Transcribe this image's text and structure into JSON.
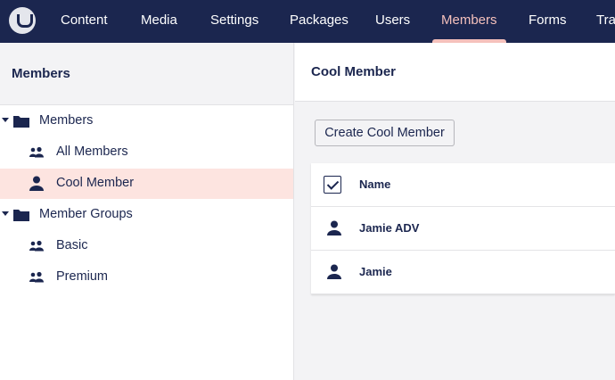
{
  "nav": {
    "items": [
      {
        "label": "Content",
        "active": false
      },
      {
        "label": "Media",
        "active": false
      },
      {
        "label": "Settings",
        "active": false
      },
      {
        "label": "Packages",
        "active": false
      },
      {
        "label": "Users",
        "active": false
      },
      {
        "label": "Members",
        "active": true
      },
      {
        "label": "Forms",
        "active": false
      },
      {
        "label": "Tra",
        "active": false
      }
    ]
  },
  "sidebar": {
    "title": "Members",
    "tree": [
      {
        "label": "Members",
        "icon": "folder-icon",
        "expanded": true
      },
      {
        "label": "All Members",
        "icon": "users-icon"
      },
      {
        "label": "Cool Member",
        "icon": "user-icon",
        "selected": true
      },
      {
        "label": "Member Groups",
        "icon": "folder-icon",
        "expanded": true
      },
      {
        "label": "Basic",
        "icon": "users-icon"
      },
      {
        "label": "Premium",
        "icon": "users-icon"
      }
    ]
  },
  "main": {
    "title": "Cool Member",
    "create_button": "Create Cool Member",
    "table": {
      "header": "Name",
      "rows": [
        "Jamie ADV",
        "Jamie"
      ]
    }
  },
  "colors": {
    "nav_bg": "#1b264f",
    "accent": "#f5c1bc",
    "selected_bg": "#fde4e0",
    "text": "#1b264f"
  }
}
